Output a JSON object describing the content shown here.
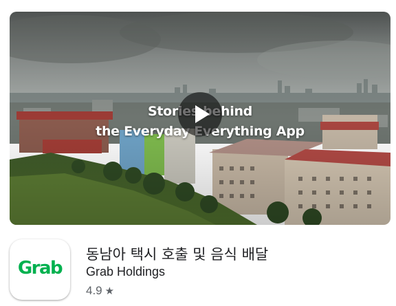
{
  "video": {
    "title_line1": "Stories behind",
    "title_line2": "the Everyday Everything App"
  },
  "app": {
    "icon_text": "Grab",
    "icon_color": "#00B14F",
    "title": "동남아 택시 호출 및 음식 배달",
    "developer": "Grab Holdings",
    "rating": "4.9",
    "rating_icon": "star-icon"
  }
}
